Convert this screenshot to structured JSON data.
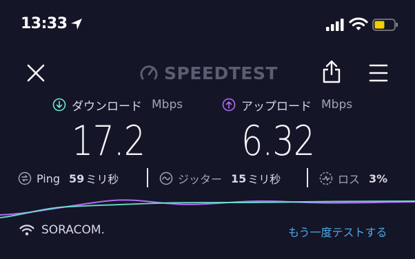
{
  "status_bar": {
    "time": "13:33",
    "icons": [
      "location-arrow-icon",
      "cellular-signal-icon",
      "wifi-icon",
      "battery-icon"
    ],
    "battery_color": "#f2d000"
  },
  "header": {
    "brand": "SPEEDTEST",
    "icons": [
      "close-icon",
      "speedometer-icon",
      "share-icon",
      "menu-icon"
    ]
  },
  "download": {
    "label": "ダウンロード",
    "unit": "Mbps",
    "value": "17.2",
    "icon": "download-arrow-icon",
    "color": "#6fe6d6"
  },
  "upload": {
    "label": "アップロード",
    "unit": "Mbps",
    "value": "6.32",
    "icon": "upload-arrow-icon",
    "color": "#b06cf2"
  },
  "stats": {
    "ping": {
      "label": "Ping",
      "value": "59",
      "unit": "ミリ秒",
      "icon": "ping-icon"
    },
    "jitter": {
      "label": "ジッター",
      "value": "15",
      "unit": "ミリ秒",
      "icon": "jitter-icon"
    },
    "loss": {
      "label": "ロス",
      "value": "3%",
      "icon": "packet-loss-icon"
    }
  },
  "footer": {
    "provider": "SORACOM.",
    "provider_icon": "wifi-icon",
    "retest": "もう一度テストする"
  },
  "colors": {
    "background": "#141526",
    "accent_link": "#4ba9e8",
    "muted": "#5b5d70"
  }
}
